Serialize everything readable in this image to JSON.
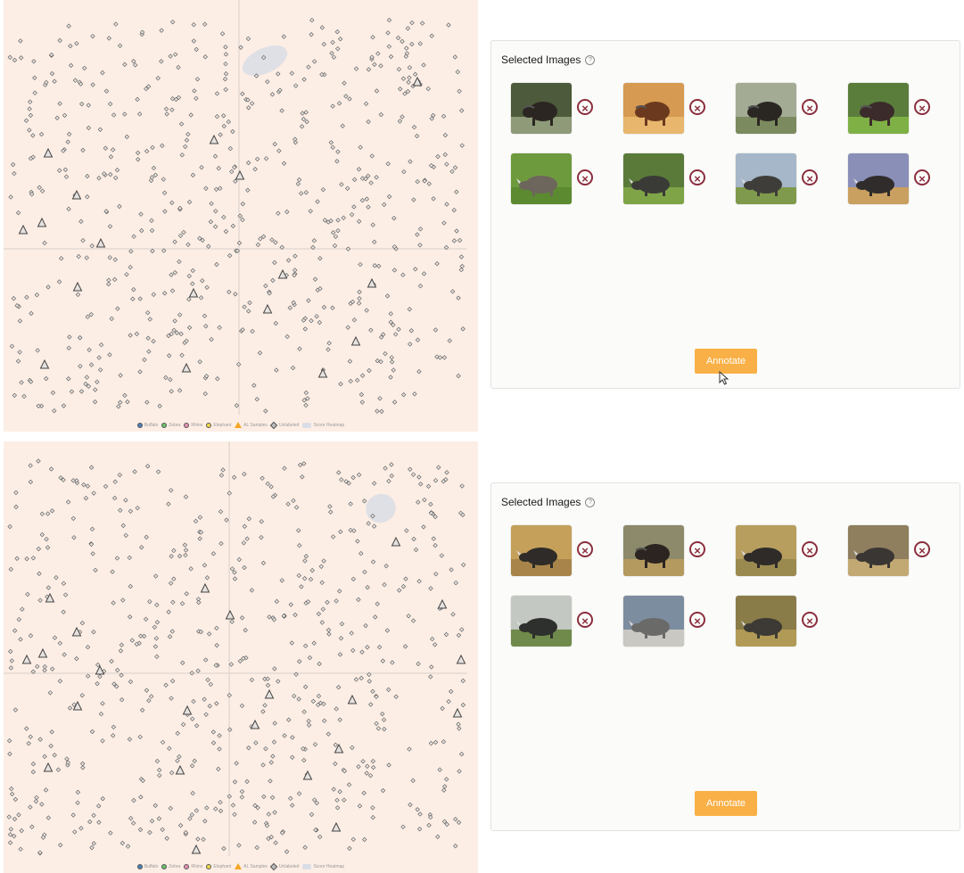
{
  "legend": {
    "items": [
      {
        "label": "Buffalo",
        "color": "#4f7fb8",
        "kind": "circle"
      },
      {
        "label": "Zebra",
        "color": "#6fbf6a",
        "kind": "circle"
      },
      {
        "label": "Rhino",
        "color": "#e58fb4",
        "kind": "circle"
      },
      {
        "label": "Elephant",
        "color": "#f0d84a",
        "kind": "circle"
      },
      {
        "label": "AL Samples",
        "color": "#f5a623",
        "kind": "triangle"
      },
      {
        "label": "Unlabeled",
        "color": "#bbbbbb",
        "kind": "diamond"
      },
      {
        "label": "Score Heatmap",
        "color": "#d9dde6",
        "kind": "area"
      }
    ]
  },
  "views": [
    {
      "title": "Selected Images",
      "annotate_label": "Annotate",
      "images": [
        {
          "subject": "buffalo",
          "palette": [
            "#4d5a3b",
            "#8e9a78",
            "#2b2621"
          ]
        },
        {
          "subject": "buffalo",
          "palette": [
            "#d69a52",
            "#e8b66d",
            "#6b3a1e"
          ]
        },
        {
          "subject": "buffalo",
          "palette": [
            "#a4ab94",
            "#7b8a5f",
            "#2a2622"
          ]
        },
        {
          "subject": "buffalo",
          "palette": [
            "#5b7d3c",
            "#7fb046",
            "#3b2b2a"
          ]
        },
        {
          "subject": "rhino",
          "palette": [
            "#6e9a3e",
            "#5b8a30",
            "#6d665c"
          ]
        },
        {
          "subject": "rhino",
          "palette": [
            "#5a7a3a",
            "#7fa448",
            "#3a3a36"
          ]
        },
        {
          "subject": "rhino",
          "palette": [
            "#a5b7c8",
            "#7f9a4c",
            "#3f3d3a"
          ]
        },
        {
          "subject": "rhino",
          "palette": [
            "#8a8fb8",
            "#c9a060",
            "#2f2c2b"
          ]
        }
      ]
    },
    {
      "title": "Selected Images",
      "annotate_label": "Annotate",
      "images": [
        {
          "subject": "rhino",
          "palette": [
            "#c4a05a",
            "#a8844a",
            "#2e2b28"
          ]
        },
        {
          "subject": "buffalo",
          "palette": [
            "#8c8a6a",
            "#b59a60",
            "#2b2420"
          ]
        },
        {
          "subject": "rhino",
          "palette": [
            "#b79e5e",
            "#9a8a50",
            "#2e2b29"
          ]
        },
        {
          "subject": "rhino",
          "palette": [
            "#8f7f5f",
            "#c2a872",
            "#3a3633"
          ]
        },
        {
          "subject": "rhino",
          "palette": [
            "#c4c8c2",
            "#6f8a4a",
            "#2e302d"
          ]
        },
        {
          "subject": "rhino",
          "palette": [
            "#7d8da0",
            "#c9c8c2",
            "#6a6a68"
          ]
        },
        {
          "subject": "rhino",
          "palette": [
            "#8a7c48",
            "#b19a56",
            "#3d3a35"
          ]
        }
      ]
    }
  ]
}
